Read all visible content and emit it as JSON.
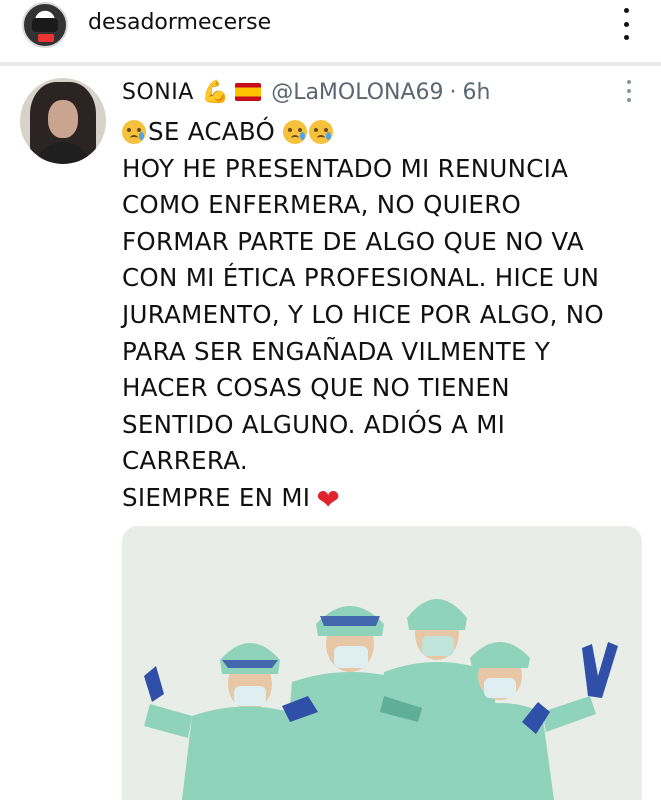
{
  "header": {
    "username": "desadormecerse"
  },
  "tweet": {
    "name": "SONIA",
    "handle": "@LaMOLONA69",
    "separator": "·",
    "time": "6h",
    "lines": [
      "SE ACABÓ",
      "HOY HE PRESENTADO MI RENUNCIA",
      "COMO ENFERMERA, NO QUIERO",
      "FORMAR PARTE DE ALGO QUE NO VA",
      "CON MI ÉTICA PROFESIONAL. HICE UN",
      "JURAMENTO, Y LO HICE POR ALGO, NO",
      "PARA SER ENGAÑADA VILMENTE Y",
      "HACER COSAS QUE NO TIENEN",
      "SENTIDO ALGUNO. ADIÓS A MI",
      "CARRERA.",
      "SIEMPRE EN MI"
    ],
    "emoji": {
      "muscle": "💪",
      "flag": "spain-flag",
      "cry": "crying-face",
      "heart": "❤"
    }
  },
  "colors": {
    "scrub": "#8fd3bd",
    "scrub_shadow": "#5fae96",
    "glove": "#2f4fa8",
    "skin": "#e8c7a6"
  }
}
